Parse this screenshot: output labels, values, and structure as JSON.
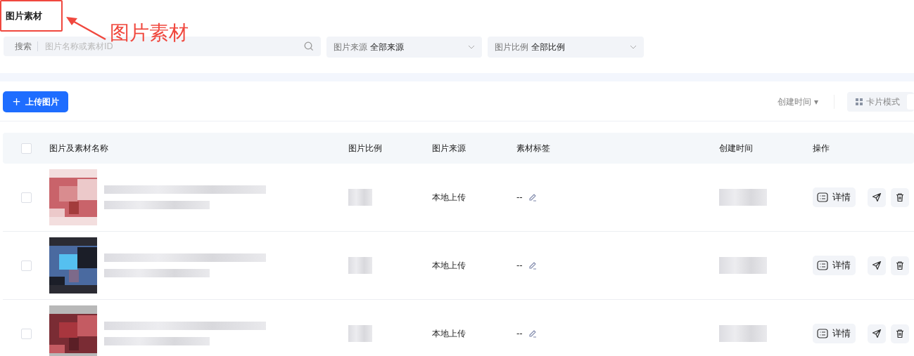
{
  "page_title": "图片素材",
  "annotation": {
    "label": "图片素材"
  },
  "filters": {
    "search": {
      "label": "搜索",
      "placeholder": "图片名称或素材ID"
    },
    "selects": [
      {
        "label": "图片来源",
        "value": "全部来源"
      },
      {
        "label": "图片比例",
        "value": "全部比例"
      }
    ]
  },
  "toolbar": {
    "upload_button": "上传图片",
    "upload_icon": "+",
    "sort": {
      "label": "创建时间",
      "caret": "▾"
    },
    "view_modes": [
      {
        "label": "卡片模式",
        "selected": false
      }
    ]
  },
  "table": {
    "select_all": {
      "checked": false
    },
    "columns": [
      "图片及素材名称",
      "图片比例",
      "图片来源",
      "素材标签",
      "创建时间",
      "操作"
    ],
    "rows": [
      {
        "checked": false,
        "source": "本地上传",
        "tags": "--",
        "detail_button": "详情"
      },
      {
        "checked": false,
        "source": "本地上传",
        "tags": "--",
        "detail_button": "详情"
      },
      {
        "checked": false,
        "source": "本地上传",
        "tags": "--",
        "detail_button": "详情"
      }
    ]
  }
}
